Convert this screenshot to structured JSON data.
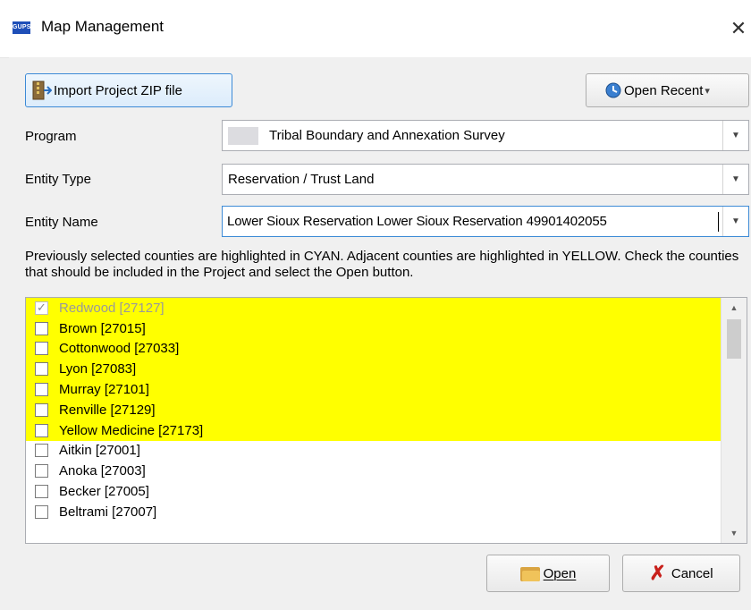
{
  "window": {
    "app_icon_text": "GUPS",
    "title": "Map Management",
    "close_glyph": "✕"
  },
  "toolbar": {
    "import_label": "Import Project ZIP file",
    "open_recent_label": "Open Recent",
    "open_recent_arrow": "▾"
  },
  "form": {
    "program_label": "Program",
    "program_value": "Tribal Boundary and Annexation Survey",
    "entity_type_label": "Entity Type",
    "entity_type_value": "Reservation / Trust Land",
    "entity_name_label": "Entity Name",
    "entity_name_value": "Lower Sioux Reservation Lower Sioux Reservation 49901402055",
    "dropdown_arrow": "▼"
  },
  "instructions": "Previously selected counties are highlighted in CYAN. Adjacent counties are highlighted in YELLOW. Check the counties that should be included in the Project and select the Open button.",
  "counties": [
    {
      "label": "Redwood [27127]",
      "checked": true,
      "disabled": true,
      "highlight": "yellow"
    },
    {
      "label": "Brown [27015]",
      "checked": false,
      "disabled": false,
      "highlight": "yellow"
    },
    {
      "label": "Cottonwood [27033]",
      "checked": false,
      "disabled": false,
      "highlight": "yellow"
    },
    {
      "label": "Lyon [27083]",
      "checked": false,
      "disabled": false,
      "highlight": "yellow"
    },
    {
      "label": "Murray [27101]",
      "checked": false,
      "disabled": false,
      "highlight": "yellow"
    },
    {
      "label": "Renville [27129]",
      "checked": false,
      "disabled": false,
      "highlight": "yellow"
    },
    {
      "label": "Yellow Medicine [27173]",
      "checked": false,
      "disabled": false,
      "highlight": "yellow"
    },
    {
      "label": "Aitkin [27001]",
      "checked": false,
      "disabled": false,
      "highlight": "none"
    },
    {
      "label": "Anoka [27003]",
      "checked": false,
      "disabled": false,
      "highlight": "none"
    },
    {
      "label": "Becker [27005]",
      "checked": false,
      "disabled": false,
      "highlight": "none"
    },
    {
      "label": "Beltrami [27007]",
      "checked": false,
      "disabled": false,
      "highlight": "none"
    }
  ],
  "colors": {
    "yellow_highlight": "#ffff00",
    "focus_border": "#3c8ad6"
  },
  "footer": {
    "open_label": "Open",
    "cancel_label": "Cancel",
    "cancel_glyph": "✗"
  }
}
